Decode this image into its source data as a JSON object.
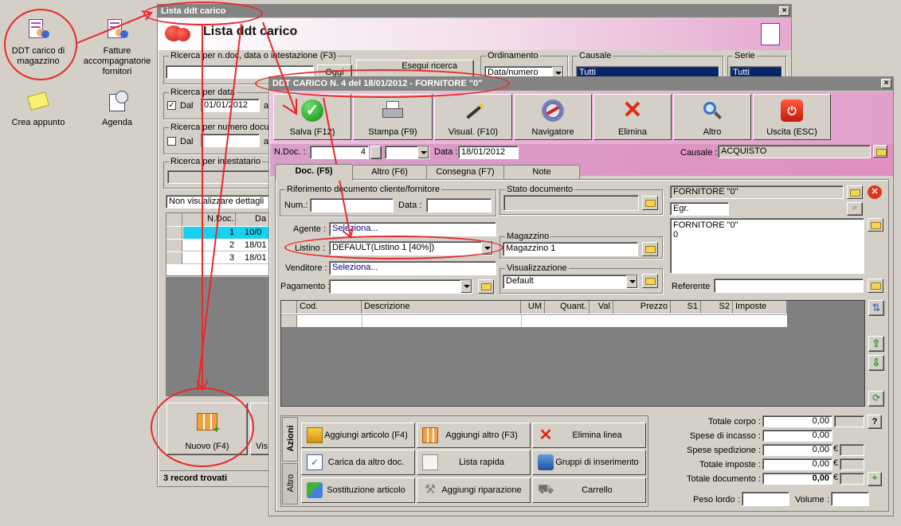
{
  "desktop": {
    "icons": [
      {
        "label": "DDT carico di magazzino",
        "icon": "ddt-icon"
      },
      {
        "label": "Fatture accompagnatorie fornitori",
        "icon": "invoice-icon"
      },
      {
        "label": "Crea appunto",
        "icon": "note-icon"
      },
      {
        "label": "Agenda",
        "icon": "agenda-icon"
      }
    ]
  },
  "list_window": {
    "title": "Lista ddt carico",
    "header": "Lista ddt carico",
    "search_group": "Ricerca per n.doc, data o intestazione (F3)",
    "oggi": "Oggi",
    "esegui": "Esegui ricerca",
    "ordinamento_label": "Ordinamento",
    "ordinamento_value": "Data/numero",
    "causale_label": "Causale",
    "causale_value": "Tutti",
    "serie_label": "Serie",
    "serie_value": "Tutti",
    "data_group": "Ricerca per data",
    "dal": "Dal",
    "dal_value": "01/01/2012",
    "a": "a",
    "numero_group": "Ricerca per numero docum",
    "intest_group": "Ricerca per intestatario",
    "details_select": "Non visualizzare dettagli",
    "table_headers": [
      "N.Doc.",
      "Da"
    ],
    "rows": [
      {
        "num": "1",
        "date": "10/0"
      },
      {
        "num": "2",
        "date": "18/01"
      },
      {
        "num": "3",
        "date": "18/01"
      }
    ],
    "nuovo": "Nuovo (F4)",
    "vis_label": "Vis",
    "status": "3 record trovati"
  },
  "ddt_window": {
    "title": "DDT CARICO N. 4  del 18/01/2012 - FORNITORE \"0\"",
    "toolbar": [
      {
        "label": "Salva (F12)",
        "icon": "save-check-icon"
      },
      {
        "label": "Stampa (F9)",
        "icon": "printer-icon"
      },
      {
        "label": "Visual. (F10)",
        "icon": "magic-wand-icon"
      },
      {
        "label": "Navigatore",
        "icon": "compass-icon"
      },
      {
        "label": "Elimina",
        "icon": "delete-x-icon"
      },
      {
        "label": "Altro",
        "icon": "search-magnifier-icon"
      },
      {
        "label": "Uscita (ESC)",
        "icon": "exit-power-icon"
      }
    ],
    "ndoc_label": "N.Doc. :",
    "ndoc_value": "4",
    "data_label": "Data :",
    "data_value": "18/01/2012",
    "causale_label": "Causale :",
    "causale_value": "ACQUISTO",
    "tabs": [
      "Doc. (F5)",
      "Altro (F6)",
      "Consegna (F7)",
      "Note"
    ],
    "rif_group": "Riferimento documento cliente/fornitore",
    "num_label": "Num.:",
    "data2_label": "Data :",
    "agente_label": "Agente :",
    "agente_value": "Seleziona...",
    "listino_label": "Listino :",
    "listino_value": "DEFAULT(Listino 1 [40%])",
    "venditore_label": "Venditore :",
    "venditore_value": "Seleziona...",
    "pagamento_label": "Pagamento :",
    "stato_group": "Stato documento",
    "magazzino_group": "Magazzino",
    "magazzino_value": "Magazzino 1",
    "visual_group": "Visualizzazione",
    "visual_value": "Default",
    "fornitore_name": "FORNITORE \"0\"",
    "title_field": "Egr.",
    "address_lines": [
      "FORNITORE \"0\"",
      "0"
    ],
    "referente_label": "Referente",
    "grid_headers": [
      "Cod.",
      "Descrizione",
      "UM",
      "Quant.",
      "Val",
      "Prezzo",
      "S1",
      "S2",
      "Imposte"
    ],
    "side_tabs": [
      "Azioni",
      "Altro"
    ],
    "actions": [
      {
        "label": "Aggiungi articolo (F4)",
        "icon": "add-box-icon"
      },
      {
        "label": "Aggiungi altro (F3)",
        "icon": "add-grid-icon"
      },
      {
        "label": "Elimina linea",
        "icon": "delete-x-icon"
      },
      {
        "label": "Carica da altro doc.",
        "icon": "checklist-icon"
      },
      {
        "label": "Lista rapida",
        "icon": "quick-list-icon"
      },
      {
        "label": "Gruppi di inserimento",
        "icon": "group-insert-icon"
      },
      {
        "label": "Sostituzione articolo",
        "icon": "replace-icon"
      },
      {
        "label": "Aggiungi riparazione",
        "icon": "wrench-icon"
      },
      {
        "label": "Carrello",
        "icon": "cart-icon"
      }
    ],
    "totals": [
      {
        "label": "Totale corpo :",
        "value": "0,00"
      },
      {
        "label": "Spese di incasso :",
        "value": "0,00"
      },
      {
        "label": "Spese spedizione :",
        "value": "0,00"
      },
      {
        "label": "Totale imposte :",
        "value": "0,00"
      },
      {
        "label": "Totale documento :",
        "value": "0,00"
      }
    ],
    "currency": "€",
    "help": "?",
    "peso_label": "Peso lordo :",
    "volume_label": "Volume :"
  },
  "annotation_color": "#e8282c"
}
